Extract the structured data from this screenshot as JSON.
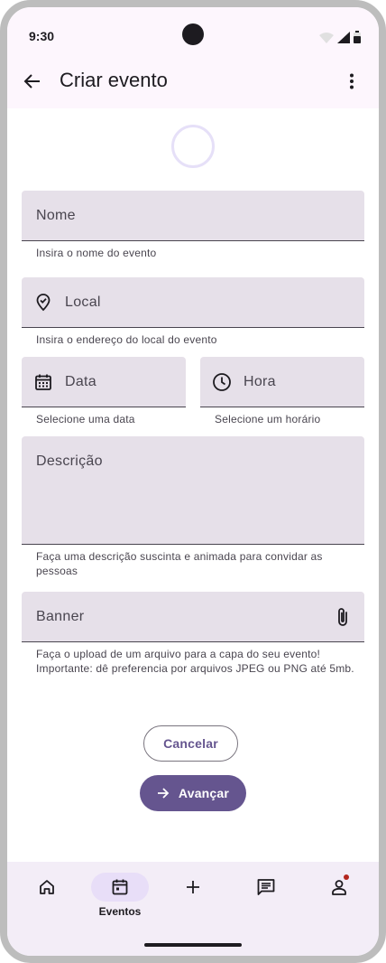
{
  "status_bar": {
    "time": "9:30"
  },
  "app_bar": {
    "title": "Criar evento"
  },
  "form": {
    "nome": {
      "label": "Nome",
      "helper": "Insira o nome do evento"
    },
    "local": {
      "label": "Local",
      "helper": "Insira o endereço do local do evento"
    },
    "data": {
      "label": "Data",
      "helper": "Selecione uma data"
    },
    "hora": {
      "label": "Hora",
      "helper": "Selecione um horário"
    },
    "descricao": {
      "label": "Descrição",
      "helper_line1": "Faça uma descrição suscinta e animada para convidar as",
      "helper_line2": "pessoas"
    },
    "banner": {
      "label": "Banner",
      "helper_line1": "Faça o upload de um arquivo para a capa do seu evento!",
      "helper_line2": "Importante: dê preferencia por arquivos JPEG ou PNG até 5mb."
    }
  },
  "actions": {
    "cancel_label": "Cancelar",
    "next_label": "Avançar"
  },
  "bottom_nav": {
    "items": [
      {
        "icon": "home-icon"
      },
      {
        "icon": "calendar-icon",
        "label": "Eventos",
        "active": true
      },
      {
        "icon": "plus-icon"
      },
      {
        "icon": "chat-icon"
      },
      {
        "icon": "person-icon",
        "badge": true
      }
    ]
  },
  "colors": {
    "primary": "#65558f",
    "surface_container": "#f3edf7",
    "field_fill": "#e6e0e9",
    "app_bar": "#fdf6fd",
    "error": "#b3261e"
  }
}
